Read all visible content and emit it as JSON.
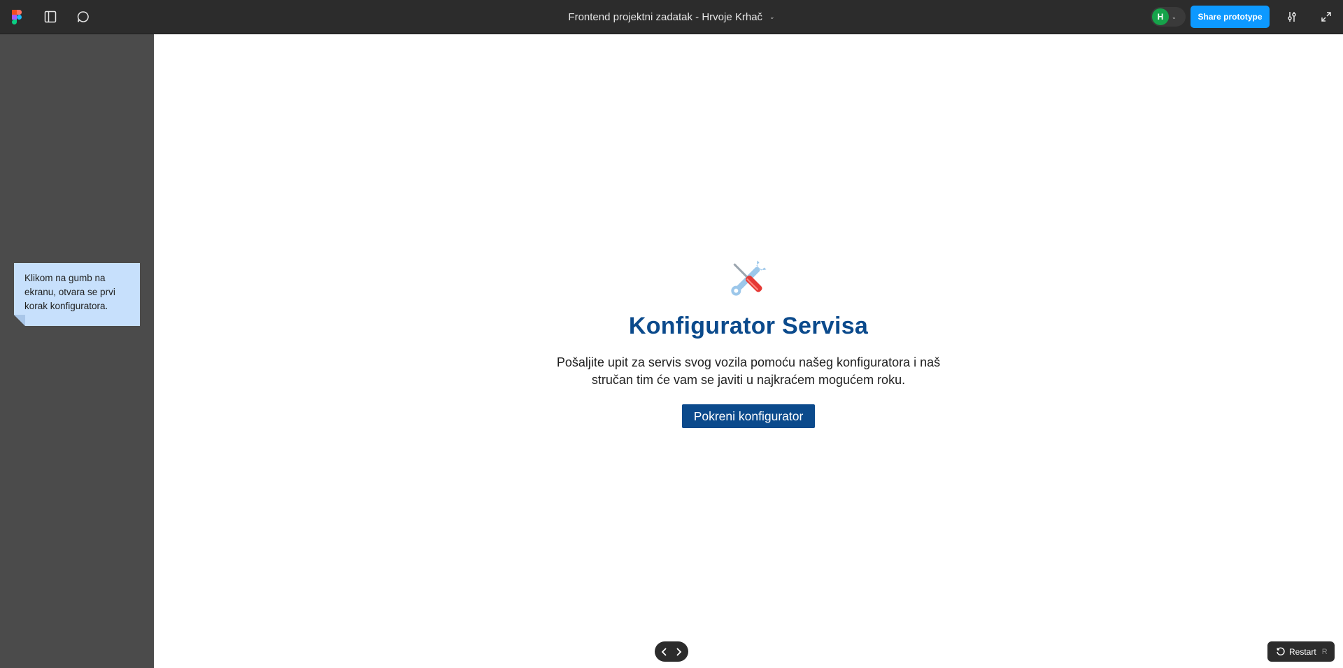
{
  "toolbar": {
    "logo_icon": "figma-logo-icon",
    "sidebar_toggle_icon": "sidebar-panel-icon",
    "comment_icon": "comment-bubble-icon",
    "file_title": "Frontend projektni zadatak - Hrvoje Krhač",
    "title_chevron": "⌄",
    "avatar_initial": "H",
    "avatar_color": "#16a34a",
    "avatar_chevron": "⌄",
    "share_label": "Share prototype",
    "share_color": "#0d99ff",
    "settings_icon": "sliders-icon",
    "fullscreen_icon": "expand-icon"
  },
  "sticky_note": {
    "text": "Klikom na gumb na ekranu, otvara se prvi korak konfiguratora.",
    "color": "#c7e0fc"
  },
  "canvas": {
    "hero_icon": "hammer-and-wrench-icon",
    "title": "Konfigurator Servisa",
    "description": "Pošaljite upit za servis svog vozila pomoću našeg konfiguratora i naš stručan tim će vam se javiti u najkraćem mogućem roku.",
    "cta_label": "Pokreni konfigurator",
    "brand_color": "#0b4a8c"
  },
  "bottom": {
    "prev_icon": "chevron-left-icon",
    "next_icon": "chevron-right-icon",
    "restart_label": "Restart",
    "restart_shortcut": "R"
  }
}
